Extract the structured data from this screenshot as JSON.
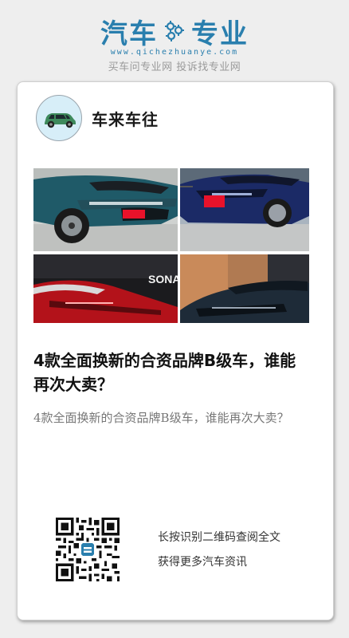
{
  "header": {
    "brand_part1": "汽车",
    "brand_part2": "专业",
    "brand_url": "www.qichezhuanye.com",
    "slogan": "买车问专业网 投诉找专业网"
  },
  "post": {
    "author_name": "车来车往",
    "title": "4款全面换新的合资品牌B级车，谁能再次大卖？",
    "summary": "4款全面换新的合资品牌B级车，谁能再次大卖？",
    "photo_text_sonata": "SONA"
  },
  "footer": {
    "qr_line1": "长按识别二维码查阅全文",
    "qr_line2": "获得更多汽车资讯"
  },
  "colors": {
    "brand_blue": "#2a7fae",
    "background": "#eeeeee",
    "card": "#ffffff"
  }
}
